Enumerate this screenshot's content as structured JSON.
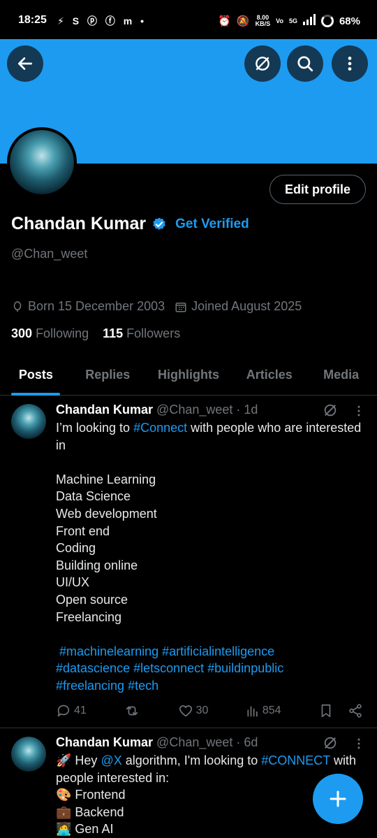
{
  "status_bar": {
    "time": "18:25",
    "notification_icons": "⚡ S ⓟ ⓕ m •",
    "net_speed": "8.00",
    "net_unit": "KB/S",
    "volte": "Vo",
    "sig5g": "5G",
    "battery": "68%"
  },
  "profile": {
    "name": "Chandan Kumar",
    "get_verified": "Get Verified",
    "handle": "@Chan_weet",
    "edit_profile": "Edit profile",
    "born": "Born 15 December 2003",
    "joined": "Joined August 2025",
    "following_count": "300",
    "following_label": "Following",
    "followers_count": "115",
    "followers_label": "Followers"
  },
  "tabs": [
    "Posts",
    "Replies",
    "Highlights",
    "Articles",
    "Media"
  ],
  "posts": [
    {
      "author": "Chandan Kumar",
      "handle": "@Chan_weet",
      "time": "· 1d",
      "intro_pre": "I’m looking to ",
      "intro_tag": "#Connect",
      "intro_post": " with people who are interested in",
      "topics": [
        "Machine Learning",
        "Data Science",
        "Web development",
        "Front end",
        "Coding",
        "Building online",
        "UI/UX",
        "Open source",
        "Freelancing"
      ],
      "hashtags_1": " #machinelearning #artificialintelligence",
      "hashtags_2": "#datascience #letsconnect #buildinpublic",
      "hashtags_3": "#freelancing #tech",
      "replies": "41",
      "likes": "30",
      "views": "854"
    },
    {
      "author": "Chandan Kumar",
      "handle": "@Chan_weet",
      "time": "· 6d",
      "line1_pre": "🚀 Hey ",
      "line1_mention": "@X",
      "line1_mid": " algorithm, I'm looking to ",
      "line1_tag": "#CONNECT",
      "line1_post": " with",
      "line2": "people interested in:",
      "line3": "🎨 Frontend",
      "line4": "💼 Backend",
      "line5": "🧑‍💻 Gen AI"
    }
  ],
  "colors": {
    "accent": "#1d9bf0",
    "background": "#000000",
    "muted": "#71767b"
  }
}
